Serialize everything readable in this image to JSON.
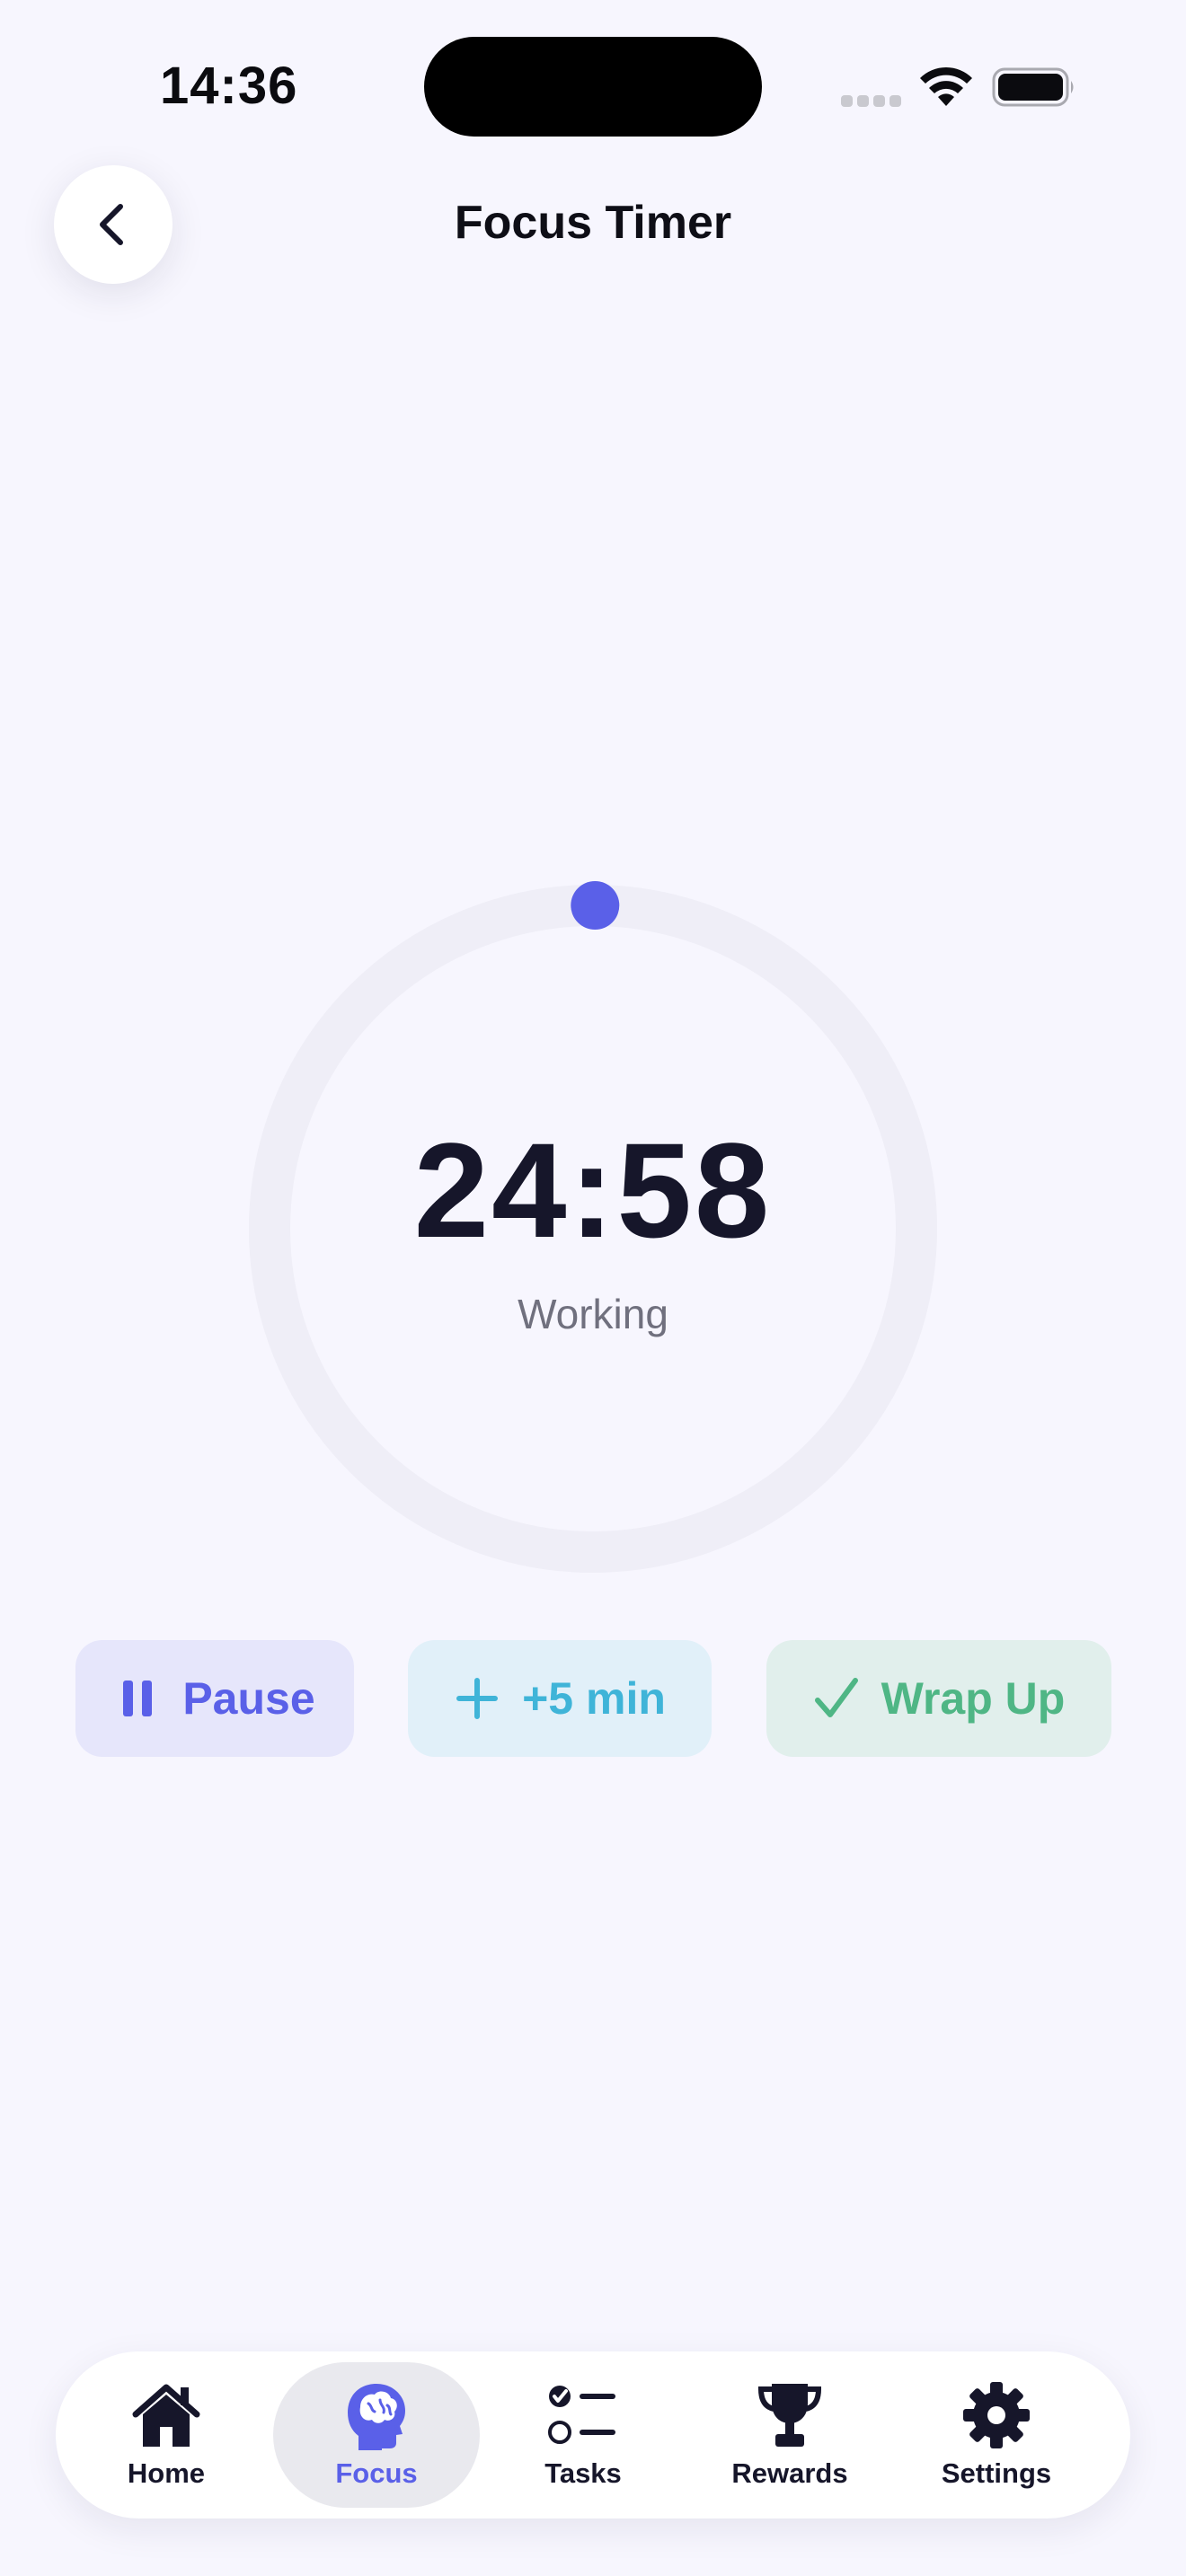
{
  "status_bar": {
    "time": "14:36"
  },
  "header": {
    "title": "Focus Timer",
    "back_icon": "chevron-left-icon"
  },
  "timer": {
    "value": "24:58",
    "status": "Working",
    "progress": 0.001,
    "accent_color": "#5a60e8",
    "track_color": "#efeef7"
  },
  "controls": {
    "pause": {
      "label": "Pause",
      "icon": "pause-icon",
      "color": "#5a60e8"
    },
    "add_time": {
      "label": "+5 min",
      "icon": "plus-icon",
      "color": "#3fb4d8"
    },
    "wrap_up": {
      "label": "Wrap Up",
      "icon": "checkmark-icon",
      "color": "#4fb685"
    }
  },
  "tab_bar": {
    "active": "Focus",
    "items": [
      {
        "label": "Home",
        "icon": "house-icon"
      },
      {
        "label": "Focus",
        "icon": "brain-head-icon"
      },
      {
        "label": "Tasks",
        "icon": "checklist-icon"
      },
      {
        "label": "Rewards",
        "icon": "trophy-icon"
      },
      {
        "label": "Settings",
        "icon": "gear-icon"
      }
    ]
  }
}
